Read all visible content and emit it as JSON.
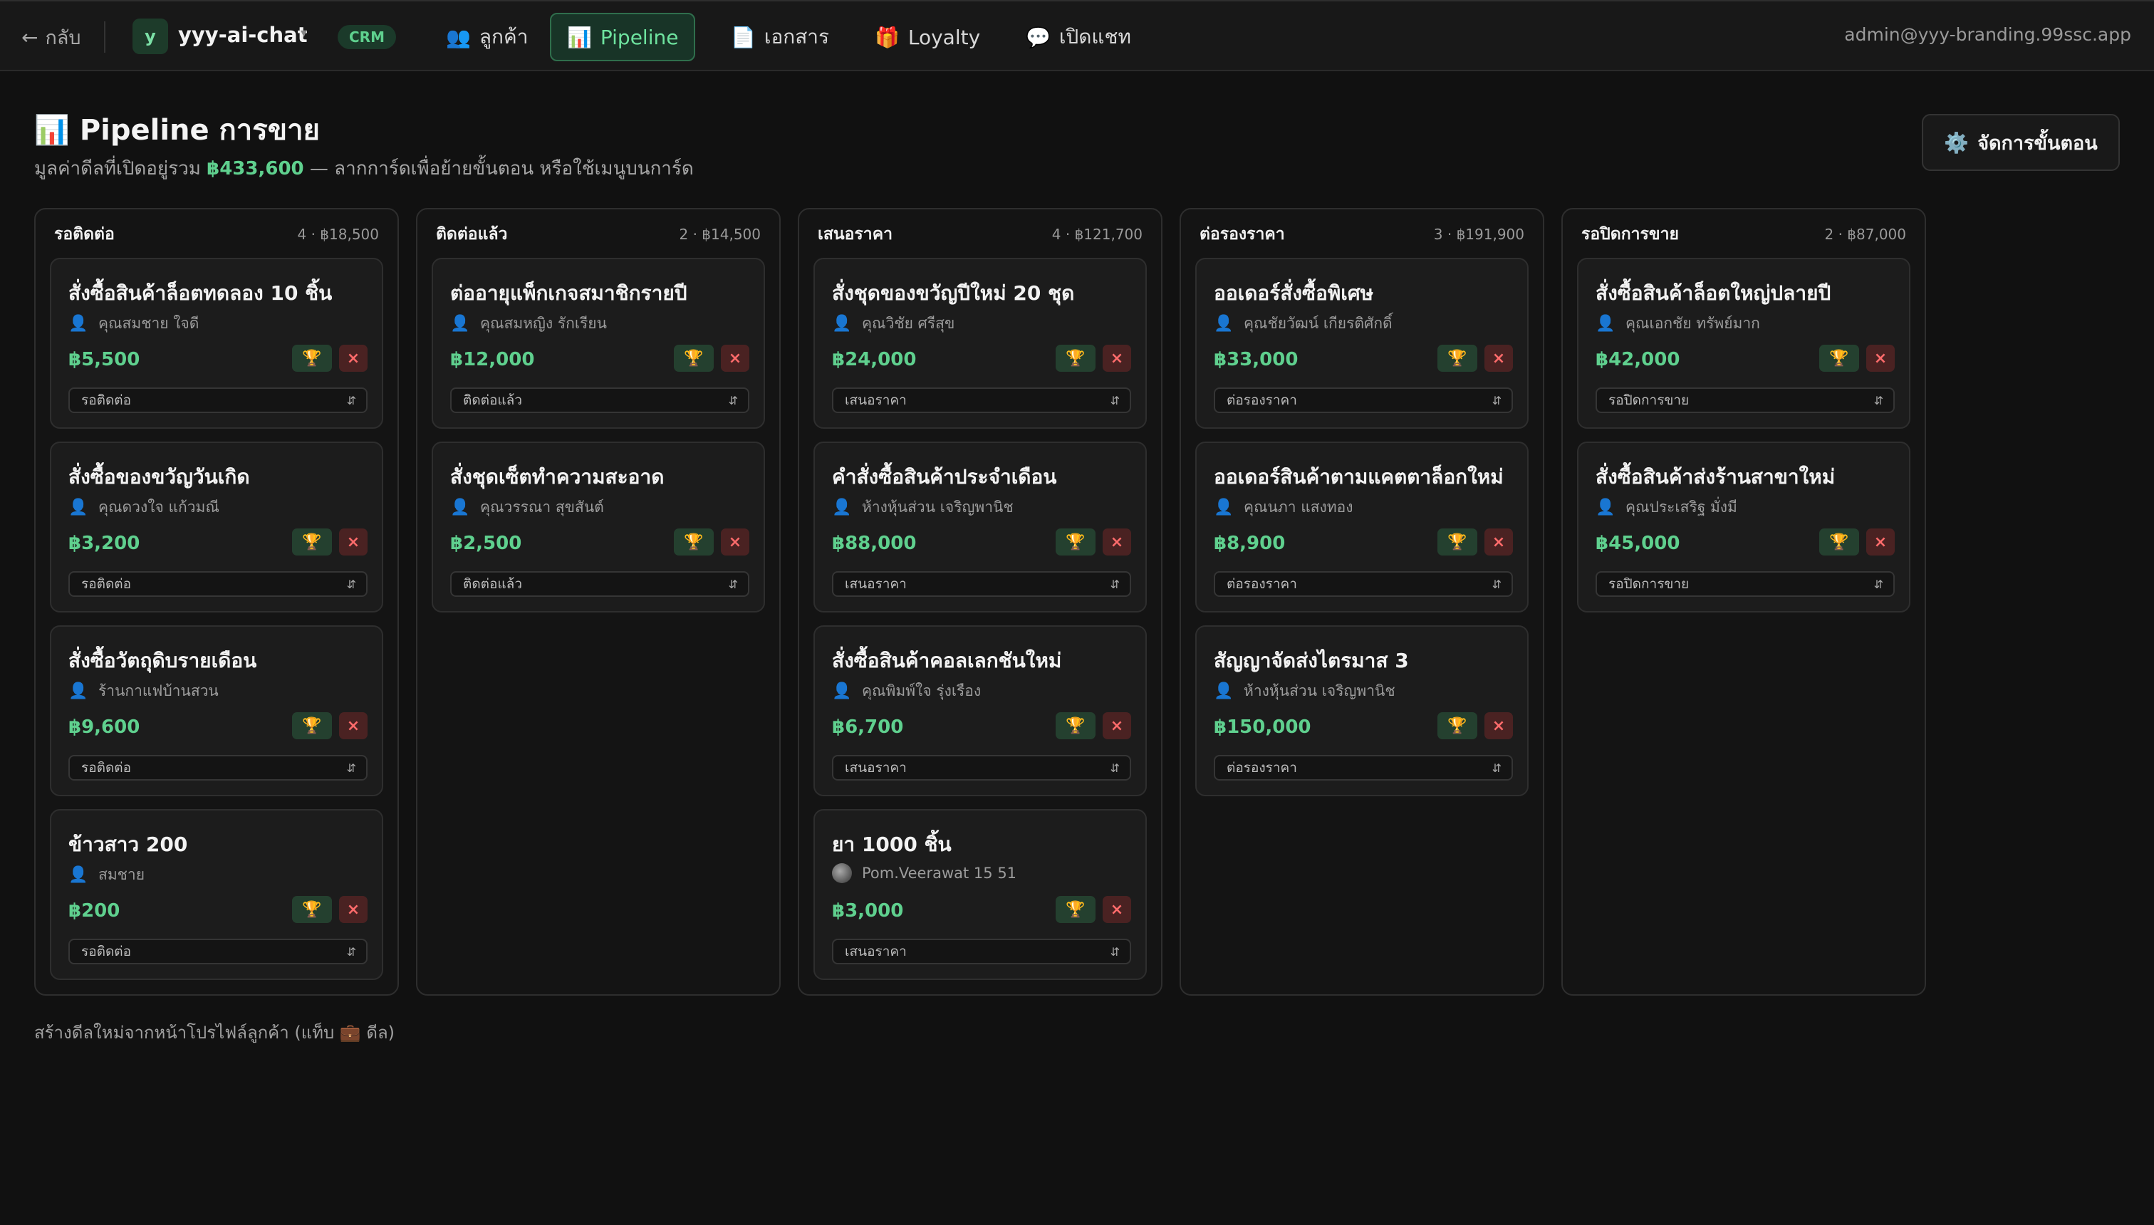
{
  "nav": {
    "back_label": "กลับ",
    "workspace_initial": "y",
    "workspace_name": "yyy-ai-chat",
    "workspace_caret": "▾",
    "module_badge": "CRM",
    "tabs": [
      {
        "icon": "👥",
        "icon_name": "users-icon",
        "label": "ลูกค้า"
      },
      {
        "icon": "📊",
        "icon_name": "bar-chart-icon",
        "label": "Pipeline"
      },
      {
        "icon": "📄",
        "icon_name": "document-icon",
        "label": "เอกสาร"
      },
      {
        "icon": "🎁",
        "icon_name": "gift-icon",
        "label": "Loyalty"
      },
      {
        "icon": "💬",
        "icon_name": "chat-bubble-icon",
        "label": "เปิดแชท"
      }
    ],
    "active_tab": "Pipeline",
    "account_email": "admin@yyy-branding.99ssc.app"
  },
  "header": {
    "title_icon": "📊",
    "title": "Pipeline การขาย",
    "subtitle_prefix": "มูลค่าดีลที่เปิดอยู่รวม",
    "subtitle_amount": "฿433,600",
    "subtitle_suffix": "— ลากการ์ดเพื่อย้ายขั้นตอน หรือใช้เมนูบนการ์ด",
    "manage_icon": "⚙️",
    "manage_label": "จัดการขั้นตอน"
  },
  "card_controls": {
    "win_icon": "🏆",
    "lose_icon": "×",
    "select_chevron": "⌃⌄",
    "person_icon": "👤"
  },
  "columns": [
    {
      "title": "รอติดต่อ",
      "meta": "4 · ฿18,500",
      "cards": [
        {
          "title": "สั่งซื้อสินค้าล็อตทดลอง 10 ชิ้น",
          "person": "คุณสมชาย ใจดี",
          "value": "฿5,500",
          "stage": "รอติดต่อ"
        },
        {
          "title": "สั่งซื้อของขวัญวันเกิด",
          "person": "คุณดวงใจ แก้วมณี",
          "value": "฿3,200",
          "stage": "รอติดต่อ"
        },
        {
          "title": "สั่งซื้อวัตถุดิบรายเดือน",
          "person": "ร้านกาแฟบ้านสวน",
          "value": "฿9,600",
          "stage": "รอติดต่อ"
        },
        {
          "title": "ข้าวสาว 200",
          "person": "สมชาย",
          "value": "฿200",
          "stage": "รอติดต่อ"
        }
      ]
    },
    {
      "title": "ติดต่อแล้ว",
      "meta": "2 · ฿14,500",
      "cards": [
        {
          "title": "ต่ออายุแพ็กเกจสมาชิกรายปี",
          "person": "คุณสมหญิง รักเรียน",
          "value": "฿12,000",
          "stage": "ติดต่อแล้ว"
        },
        {
          "title": "สั่งชุดเซ็ตทำความสะอาด",
          "person": "คุณวรรณา สุขสันต์",
          "value": "฿2,500",
          "stage": "ติดต่อแล้ว"
        }
      ]
    },
    {
      "title": "เสนอราคา",
      "meta": "4 · ฿121,700",
      "cards": [
        {
          "title": "สั่งชุดของขวัญปีใหม่ 20 ชุด",
          "person": "คุณวิชัย ศรีสุข",
          "value": "฿24,000",
          "stage": "เสนอราคา"
        },
        {
          "title": "คำสั่งซื้อสินค้าประจำเดือน",
          "person": "ห้างหุ้นส่วน เจริญพานิช",
          "value": "฿88,000",
          "stage": "เสนอราคา"
        },
        {
          "title": "สั่งซื้อสินค้าคอลเลกชันใหม่",
          "person": "คุณพิมพ์ใจ รุ่งเรือง",
          "value": "฿6,700",
          "stage": "เสนอราคา"
        },
        {
          "title": "ยา 1000 ชิ้น",
          "person": "Pom.Veerawat 15 51",
          "value": "฿3,000",
          "stage": "เสนอราคา",
          "photo": true
        }
      ]
    },
    {
      "title": "ต่อรองราคา",
      "meta": "3 · ฿191,900",
      "cards": [
        {
          "title": "ออเดอร์สั่งซื้อพิเศษ",
          "person": "คุณชัยวัฒน์ เกียรติศักดิ์",
          "value": "฿33,000",
          "stage": "ต่อรองราคา"
        },
        {
          "title": "ออเดอร์สินค้าตามแคตตาล็อกใหม่",
          "person": "คุณนภา แสงทอง",
          "value": "฿8,900",
          "stage": "ต่อรองราคา"
        },
        {
          "title": "สัญญาจัดส่งไตรมาส 3",
          "person": "ห้างหุ้นส่วน เจริญพานิช",
          "value": "฿150,000",
          "stage": "ต่อรองราคา"
        }
      ]
    },
    {
      "title": "รอปิดการขาย",
      "meta": "2 · ฿87,000",
      "cards": [
        {
          "title": "สั่งซื้อสินค้าล็อตใหญ่ปลายปี",
          "person": "คุณเอกชัย ทรัพย์มาก",
          "value": "฿42,000",
          "stage": "รอปิดการขาย"
        },
        {
          "title": "สั่งซื้อสินค้าส่งร้านสาขาใหม่",
          "person": "คุณประเสริฐ มั่งมี",
          "value": "฿45,000",
          "stage": "รอปิดการขาย"
        }
      ]
    }
  ],
  "footer": {
    "note": "สร้างดีลใหม่จากหน้าโปรไฟล์ลูกค้า (แท็บ 💼 ดีล)"
  },
  "colors": {
    "background": "#111111",
    "accent_green": "#5fd08e",
    "danger_red": "#ff6b6b"
  }
}
